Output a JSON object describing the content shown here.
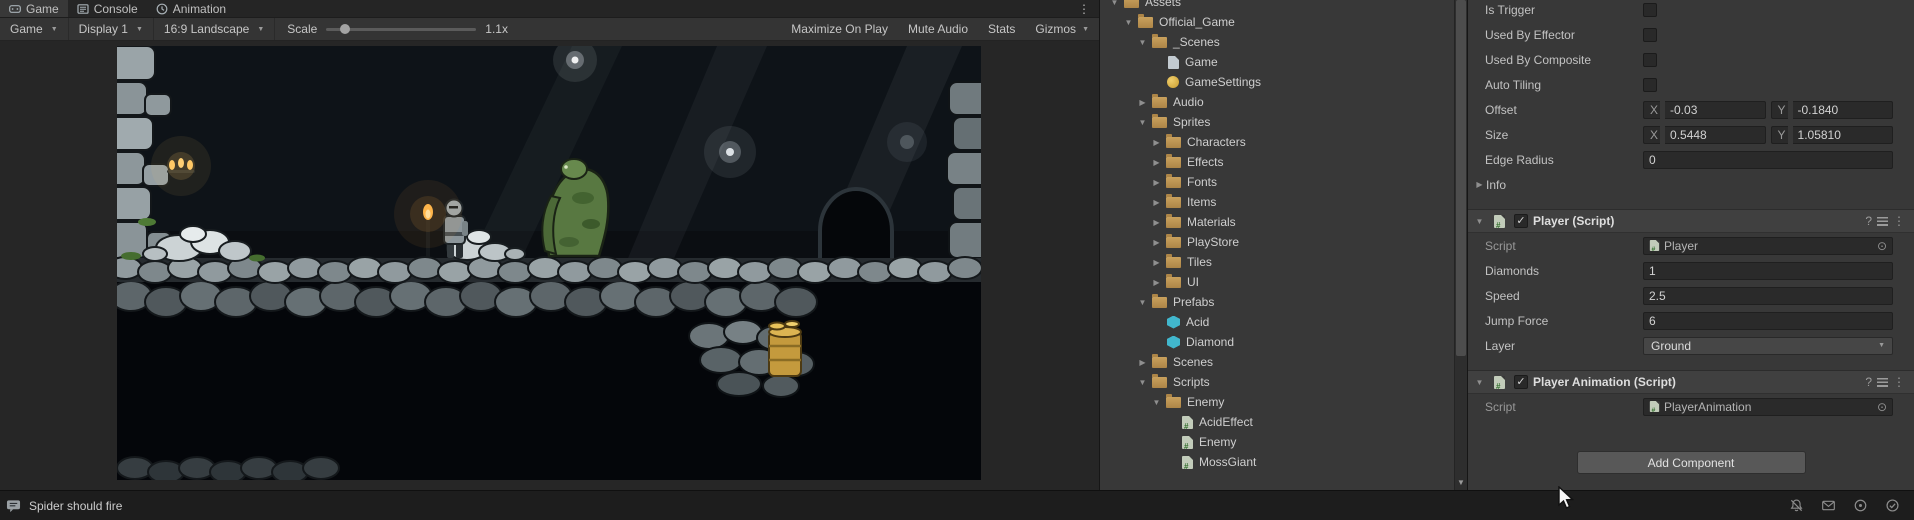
{
  "colors": {
    "folder_icon": "#C09A56",
    "prefab_icon": "#41B7CD",
    "script_icon_accent": "#33702E",
    "torch_glow": "#FFB84D",
    "panel_background": "#383838",
    "field_background": "#2A2A2A"
  },
  "icons": {
    "chevron_down": "▼",
    "foldout_open": "▼",
    "foldout_closed": "▶",
    "kebab": "⋮",
    "help": "?",
    "object_picker": "⊙",
    "check": "✓"
  },
  "game_panel": {
    "tabs": [
      {
        "label": "Game",
        "active": true
      },
      {
        "label": "Console",
        "active": false
      },
      {
        "label": "Animation",
        "active": false
      }
    ],
    "toolbar": {
      "view_dropdown": "Game",
      "display_dropdown": "Display 1",
      "aspect_dropdown": "16:9 Landscape",
      "scale_label": "Scale",
      "scale_value": "1.1x",
      "maximize_on_play": "Maximize On Play",
      "mute_audio": "Mute Audio",
      "stats": "Stats",
      "gizmos": "Gizmos"
    },
    "scene": {
      "description": "Dark 2D dungeon platformer scene",
      "entities": [
        "stone walls",
        "cobblestone platform",
        "white rock piles",
        "knight player",
        "moss giant enemy",
        "standing torch",
        "chandelier",
        "hanging lamps",
        "gold barrel",
        "stone archway"
      ]
    }
  },
  "project_panel": {
    "items": [
      {
        "label": "Assets",
        "depth": 0,
        "icon": "folder",
        "expanded": true
      },
      {
        "label": "Official_Game",
        "depth": 1,
        "icon": "folder",
        "expanded": true
      },
      {
        "label": "_Scenes",
        "depth": 2,
        "icon": "folder",
        "expanded": true
      },
      {
        "label": "Game",
        "depth": 3,
        "icon": "scene"
      },
      {
        "label": "GameSettings",
        "depth": 3,
        "icon": "asset"
      },
      {
        "label": "Audio",
        "depth": 2,
        "icon": "folder",
        "expanded": false
      },
      {
        "label": "Sprites",
        "depth": 2,
        "icon": "folder",
        "expanded": true
      },
      {
        "label": "Characters",
        "depth": 3,
        "icon": "folder",
        "expanded": false
      },
      {
        "label": "Effects",
        "depth": 3,
        "icon": "folder",
        "expanded": false
      },
      {
        "label": "Fonts",
        "depth": 3,
        "icon": "folder",
        "expanded": false
      },
      {
        "label": "Items",
        "depth": 3,
        "icon": "folder",
        "expanded": false
      },
      {
        "label": "Materials",
        "depth": 3,
        "icon": "folder",
        "expanded": false
      },
      {
        "label": "PlayStore",
        "depth": 3,
        "icon": "folder",
        "expanded": false
      },
      {
        "label": "Tiles",
        "depth": 3,
        "icon": "folder",
        "expanded": false
      },
      {
        "label": "UI",
        "depth": 3,
        "icon": "folder",
        "expanded": false
      },
      {
        "label": "Prefabs",
        "depth": 2,
        "icon": "folder",
        "expanded": true
      },
      {
        "label": "Acid",
        "depth": 3,
        "icon": "prefab"
      },
      {
        "label": "Diamond",
        "depth": 3,
        "icon": "prefab"
      },
      {
        "label": "Scenes",
        "depth": 2,
        "icon": "folder",
        "expanded": false
      },
      {
        "label": "Scripts",
        "depth": 2,
        "icon": "folder",
        "expanded": true
      },
      {
        "label": "Enemy",
        "depth": 3,
        "icon": "folder",
        "expanded": true
      },
      {
        "label": "AcidEffect",
        "depth": 4,
        "icon": "script"
      },
      {
        "label": "Enemy",
        "depth": 4,
        "icon": "script"
      },
      {
        "label": "MossGiant",
        "depth": 4,
        "icon": "script"
      }
    ]
  },
  "inspector": {
    "axis_x": "X",
    "axis_y": "Y",
    "collider": {
      "checkbox_rows": [
        {
          "label": "Is Trigger",
          "checked": false
        },
        {
          "label": "Used By Effector",
          "checked": false
        },
        {
          "label": "Used By Composite",
          "checked": false
        },
        {
          "label": "Auto Tiling",
          "checked": false
        }
      ],
      "offset": {
        "label": "Offset",
        "x": "-0.03",
        "y": "-0.1840"
      },
      "size": {
        "label": "Size",
        "x": "0.5448",
        "y": "1.05810"
      },
      "edge_radius": {
        "label": "Edge Radius",
        "value": "0"
      },
      "info_label": "Info"
    },
    "player_script": {
      "title": "Player (Script)",
      "enabled": true,
      "script_label": "Script",
      "script_value": "Player",
      "fields": [
        {
          "label": "Diamonds",
          "value": "1"
        },
        {
          "label": "Speed",
          "value": "2.5"
        },
        {
          "label": "Jump Force",
          "value": "6"
        }
      ],
      "layer_label": "Layer",
      "layer_value": "Ground"
    },
    "player_animation": {
      "title": "Player Animation (Script)",
      "enabled": true,
      "script_label": "Script",
      "script_value": "PlayerAnimation"
    },
    "add_component_label": "Add Component"
  },
  "status_bar": {
    "message": "Spider should fire"
  }
}
